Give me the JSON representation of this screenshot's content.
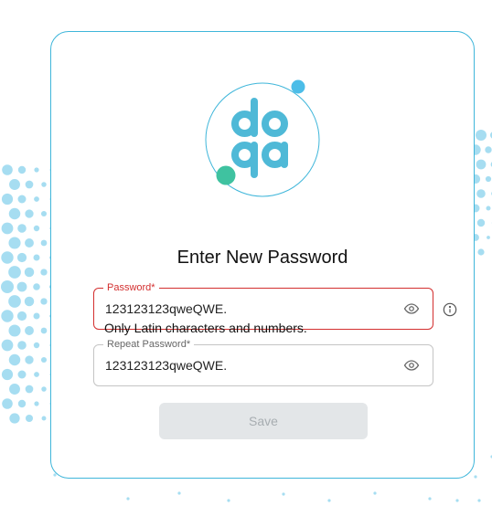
{
  "brand": {
    "logo_text": "doqa",
    "primary_color": "#3fb6da",
    "accent_color": "#3fc2a0",
    "dot_color": "#4cbde8"
  },
  "form": {
    "title": "Enter New Password",
    "password": {
      "label": "Password*",
      "value": "123123123qweQWE.",
      "error": "Only Latin characters and numbers.",
      "icon": "eye-icon"
    },
    "repeat_password": {
      "label": "Repeat Password*",
      "value": "123123123qweQWE.",
      "icon": "eye-icon"
    },
    "info_icon": "info-icon",
    "save_label": "Save",
    "save_disabled": true
  }
}
